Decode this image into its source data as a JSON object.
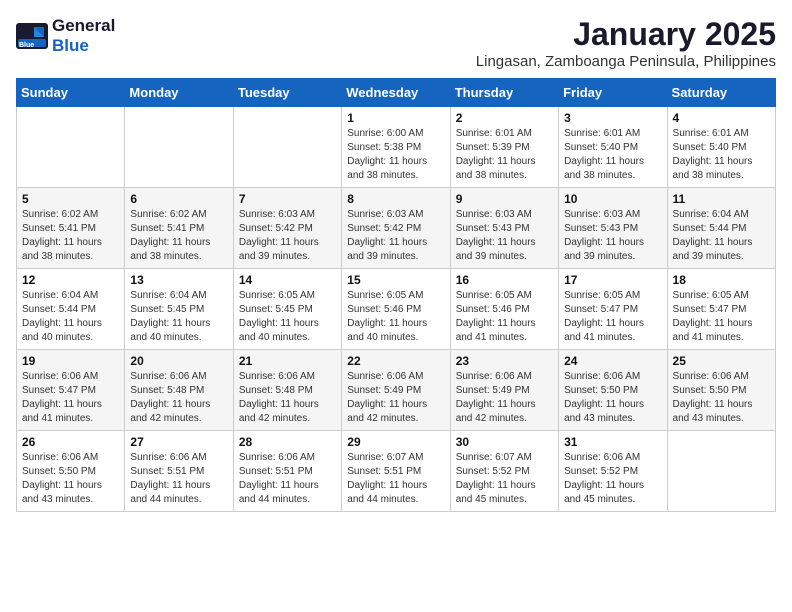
{
  "logo": {
    "general": "General",
    "blue": "Blue"
  },
  "title": "January 2025",
  "location": "Lingasan, Zamboanga Peninsula, Philippines",
  "weekdays": [
    "Sunday",
    "Monday",
    "Tuesday",
    "Wednesday",
    "Thursday",
    "Friday",
    "Saturday"
  ],
  "weeks": [
    [
      {
        "day": "",
        "sunrise": "",
        "sunset": "",
        "daylight": ""
      },
      {
        "day": "",
        "sunrise": "",
        "sunset": "",
        "daylight": ""
      },
      {
        "day": "",
        "sunrise": "",
        "sunset": "",
        "daylight": ""
      },
      {
        "day": "1",
        "sunrise": "Sunrise: 6:00 AM",
        "sunset": "Sunset: 5:38 PM",
        "daylight": "Daylight: 11 hours and 38 minutes."
      },
      {
        "day": "2",
        "sunrise": "Sunrise: 6:01 AM",
        "sunset": "Sunset: 5:39 PM",
        "daylight": "Daylight: 11 hours and 38 minutes."
      },
      {
        "day": "3",
        "sunrise": "Sunrise: 6:01 AM",
        "sunset": "Sunset: 5:40 PM",
        "daylight": "Daylight: 11 hours and 38 minutes."
      },
      {
        "day": "4",
        "sunrise": "Sunrise: 6:01 AM",
        "sunset": "Sunset: 5:40 PM",
        "daylight": "Daylight: 11 hours and 38 minutes."
      }
    ],
    [
      {
        "day": "5",
        "sunrise": "Sunrise: 6:02 AM",
        "sunset": "Sunset: 5:41 PM",
        "daylight": "Daylight: 11 hours and 38 minutes."
      },
      {
        "day": "6",
        "sunrise": "Sunrise: 6:02 AM",
        "sunset": "Sunset: 5:41 PM",
        "daylight": "Daylight: 11 hours and 38 minutes."
      },
      {
        "day": "7",
        "sunrise": "Sunrise: 6:03 AM",
        "sunset": "Sunset: 5:42 PM",
        "daylight": "Daylight: 11 hours and 39 minutes."
      },
      {
        "day": "8",
        "sunrise": "Sunrise: 6:03 AM",
        "sunset": "Sunset: 5:42 PM",
        "daylight": "Daylight: 11 hours and 39 minutes."
      },
      {
        "day": "9",
        "sunrise": "Sunrise: 6:03 AM",
        "sunset": "Sunset: 5:43 PM",
        "daylight": "Daylight: 11 hours and 39 minutes."
      },
      {
        "day": "10",
        "sunrise": "Sunrise: 6:03 AM",
        "sunset": "Sunset: 5:43 PM",
        "daylight": "Daylight: 11 hours and 39 minutes."
      },
      {
        "day": "11",
        "sunrise": "Sunrise: 6:04 AM",
        "sunset": "Sunset: 5:44 PM",
        "daylight": "Daylight: 11 hours and 39 minutes."
      }
    ],
    [
      {
        "day": "12",
        "sunrise": "Sunrise: 6:04 AM",
        "sunset": "Sunset: 5:44 PM",
        "daylight": "Daylight: 11 hours and 40 minutes."
      },
      {
        "day": "13",
        "sunrise": "Sunrise: 6:04 AM",
        "sunset": "Sunset: 5:45 PM",
        "daylight": "Daylight: 11 hours and 40 minutes."
      },
      {
        "day": "14",
        "sunrise": "Sunrise: 6:05 AM",
        "sunset": "Sunset: 5:45 PM",
        "daylight": "Daylight: 11 hours and 40 minutes."
      },
      {
        "day": "15",
        "sunrise": "Sunrise: 6:05 AM",
        "sunset": "Sunset: 5:46 PM",
        "daylight": "Daylight: 11 hours and 40 minutes."
      },
      {
        "day": "16",
        "sunrise": "Sunrise: 6:05 AM",
        "sunset": "Sunset: 5:46 PM",
        "daylight": "Daylight: 11 hours and 41 minutes."
      },
      {
        "day": "17",
        "sunrise": "Sunrise: 6:05 AM",
        "sunset": "Sunset: 5:47 PM",
        "daylight": "Daylight: 11 hours and 41 minutes."
      },
      {
        "day": "18",
        "sunrise": "Sunrise: 6:05 AM",
        "sunset": "Sunset: 5:47 PM",
        "daylight": "Daylight: 11 hours and 41 minutes."
      }
    ],
    [
      {
        "day": "19",
        "sunrise": "Sunrise: 6:06 AM",
        "sunset": "Sunset: 5:47 PM",
        "daylight": "Daylight: 11 hours and 41 minutes."
      },
      {
        "day": "20",
        "sunrise": "Sunrise: 6:06 AM",
        "sunset": "Sunset: 5:48 PM",
        "daylight": "Daylight: 11 hours and 42 minutes."
      },
      {
        "day": "21",
        "sunrise": "Sunrise: 6:06 AM",
        "sunset": "Sunset: 5:48 PM",
        "daylight": "Daylight: 11 hours and 42 minutes."
      },
      {
        "day": "22",
        "sunrise": "Sunrise: 6:06 AM",
        "sunset": "Sunset: 5:49 PM",
        "daylight": "Daylight: 11 hours and 42 minutes."
      },
      {
        "day": "23",
        "sunrise": "Sunrise: 6:06 AM",
        "sunset": "Sunset: 5:49 PM",
        "daylight": "Daylight: 11 hours and 42 minutes."
      },
      {
        "day": "24",
        "sunrise": "Sunrise: 6:06 AM",
        "sunset": "Sunset: 5:50 PM",
        "daylight": "Daylight: 11 hours and 43 minutes."
      },
      {
        "day": "25",
        "sunrise": "Sunrise: 6:06 AM",
        "sunset": "Sunset: 5:50 PM",
        "daylight": "Daylight: 11 hours and 43 minutes."
      }
    ],
    [
      {
        "day": "26",
        "sunrise": "Sunrise: 6:06 AM",
        "sunset": "Sunset: 5:50 PM",
        "daylight": "Daylight: 11 hours and 43 minutes."
      },
      {
        "day": "27",
        "sunrise": "Sunrise: 6:06 AM",
        "sunset": "Sunset: 5:51 PM",
        "daylight": "Daylight: 11 hours and 44 minutes."
      },
      {
        "day": "28",
        "sunrise": "Sunrise: 6:06 AM",
        "sunset": "Sunset: 5:51 PM",
        "daylight": "Daylight: 11 hours and 44 minutes."
      },
      {
        "day": "29",
        "sunrise": "Sunrise: 6:07 AM",
        "sunset": "Sunset: 5:51 PM",
        "daylight": "Daylight: 11 hours and 44 minutes."
      },
      {
        "day": "30",
        "sunrise": "Sunrise: 6:07 AM",
        "sunset": "Sunset: 5:52 PM",
        "daylight": "Daylight: 11 hours and 45 minutes."
      },
      {
        "day": "31",
        "sunrise": "Sunrise: 6:06 AM",
        "sunset": "Sunset: 5:52 PM",
        "daylight": "Daylight: 11 hours and 45 minutes."
      },
      {
        "day": "",
        "sunrise": "",
        "sunset": "",
        "daylight": ""
      }
    ]
  ]
}
